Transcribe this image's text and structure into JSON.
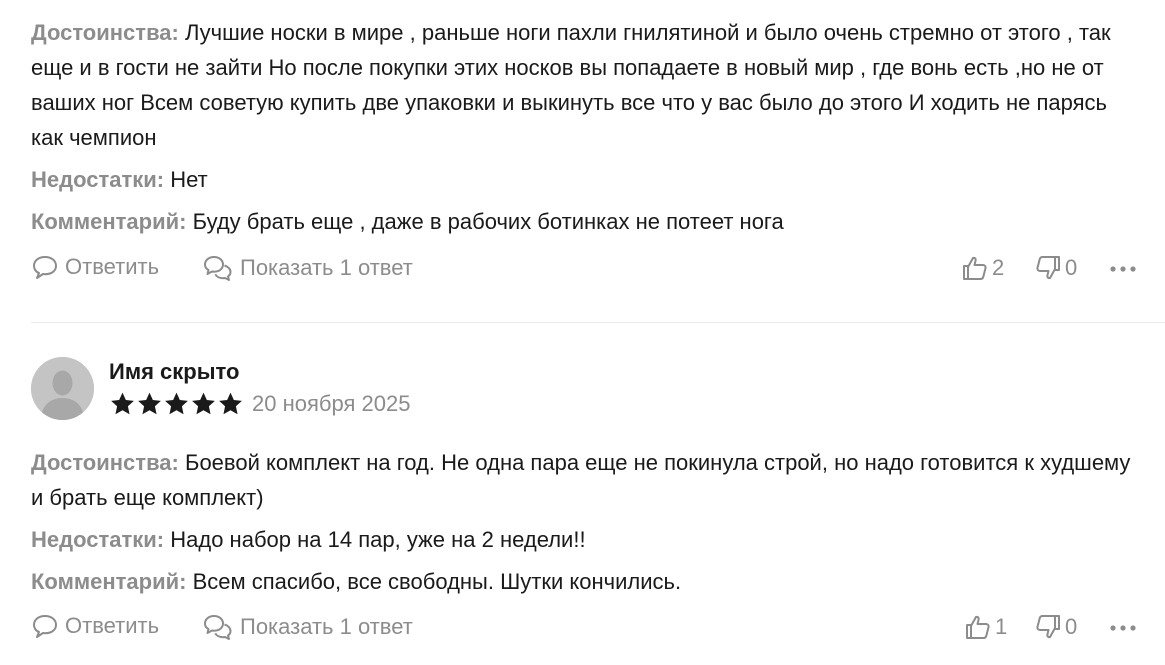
{
  "reviews": [
    {
      "pros_label": "Достоинства:",
      "pros_text": "Лучшие носки в мире , раньше ноги пахли гнилятиной и было очень стремно от этого , так еще и в гости не зайти Но после покупки этих носков вы попадаете в новый мир , где вонь есть ,но не от ваших ног Всем советую купить две упаковки и выкинуть все что у вас было до этого И ходить не парясь как чемпион",
      "cons_label": "Недостатки:",
      "cons_text": "Нет",
      "comment_label": "Комментарий:",
      "comment_text": "Буду брать еще , даже в рабочих ботинках не потеет нога",
      "reply_label": "Ответить",
      "show_replies_label": "Показать 1 ответ",
      "likes": "2",
      "dislikes": "0"
    },
    {
      "author": "Имя скрыто",
      "rating": 5,
      "date": "20 ноября 2025",
      "pros_label": "Достоинства:",
      "pros_text": "Боевой комплект на год. Не одна пара еще не покинула строй, но надо готовится к худшему и брать еще комплект)",
      "cons_label": "Недостатки:",
      "cons_text": "Надо набор на 14 пар, уже на 2 недели!!",
      "comment_label": "Комментарий:",
      "comment_text": "Всем спасибо, все свободны. Шутки кончились.",
      "reply_label": "Ответить",
      "show_replies_label": "Показать 1 ответ",
      "likes": "1",
      "dislikes": "0"
    }
  ],
  "colors": {
    "label": "#8c8c8c",
    "text": "#1a1a1a",
    "star": "#1a1a1a",
    "divider": "#ebebeb"
  }
}
